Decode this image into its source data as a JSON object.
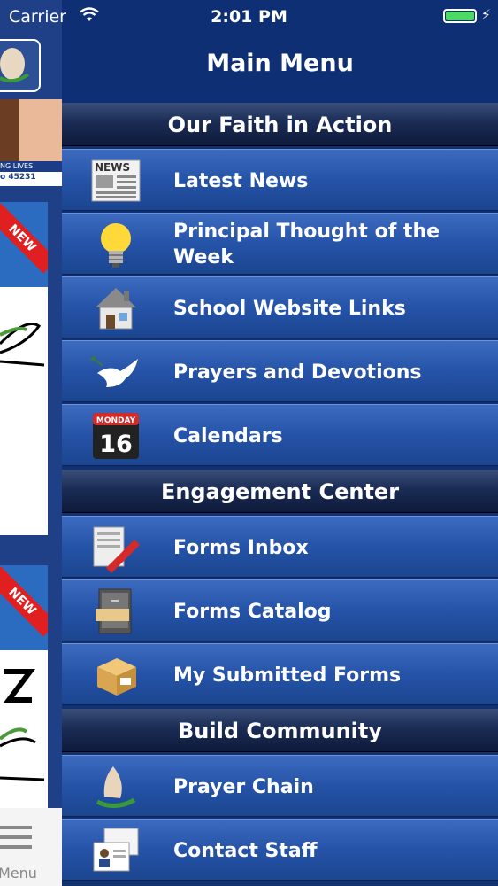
{
  "status_bar": {
    "carrier": "Carrier",
    "time": "2:01 PM",
    "battery_color": "#4cd964"
  },
  "background_app": {
    "photo_caption": "NG LIVES",
    "photo_zip": "o 45231",
    "ribbon_text": "NEW",
    "tab_label": "Menu"
  },
  "menu": {
    "title": "Main Menu",
    "sections": [
      {
        "title": "Our Faith in Action",
        "items": [
          {
            "label": "Latest News",
            "icon": "newspaper-icon"
          },
          {
            "label": "Principal Thought of the Week",
            "icon": "lightbulb-icon"
          },
          {
            "label": "School Website Links",
            "icon": "house-icon"
          },
          {
            "label": "Prayers and Devotions",
            "icon": "dove-icon"
          },
          {
            "label": "Calendars",
            "icon": "calendar-icon",
            "calendar_day": "MONDAY",
            "calendar_date": "16"
          }
        ]
      },
      {
        "title": "Engagement Center",
        "items": [
          {
            "label": "Forms Inbox",
            "icon": "forms-pen-icon"
          },
          {
            "label": "Forms Catalog",
            "icon": "file-cabinet-icon"
          },
          {
            "label": "My Submitted Forms",
            "icon": "package-icon"
          }
        ]
      },
      {
        "title": "Build Community",
        "items": [
          {
            "label": "Prayer Chain",
            "icon": "praying-hands-icon"
          },
          {
            "label": "Contact Staff",
            "icon": "contact-cards-icon"
          }
        ]
      }
    ]
  }
}
